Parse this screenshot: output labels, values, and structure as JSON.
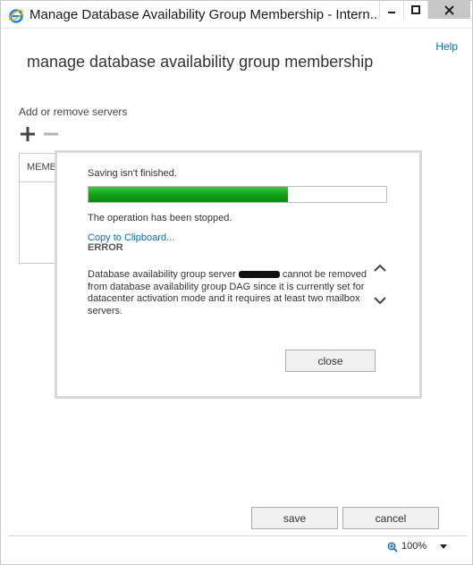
{
  "window": {
    "title": "Manage Database Availability Group Membership - Intern..."
  },
  "page": {
    "help_label": "Help",
    "title": "manage database availability group membership",
    "section_label": "Add or remove servers",
    "members_column": "MEMBE"
  },
  "dialog": {
    "saving_text": "Saving isn't finished.",
    "progress_fraction": 0.67,
    "stopped_text": "The operation has been stopped.",
    "copy_link": "Copy to Clipboard...",
    "error_heading": "ERROR",
    "error_prefix": "Database availability group server",
    "error_suffix": "cannot be removed from database availability group DAG since it is currently set for datacenter activation mode and it requires at least two mailbox servers.",
    "close_label": "close"
  },
  "footer": {
    "save_label": "save",
    "cancel_label": "cancel"
  },
  "statusbar": {
    "zoom": "100%"
  },
  "colors": {
    "progress_green": "#10a314",
    "link_blue": "#0a6bb5"
  }
}
